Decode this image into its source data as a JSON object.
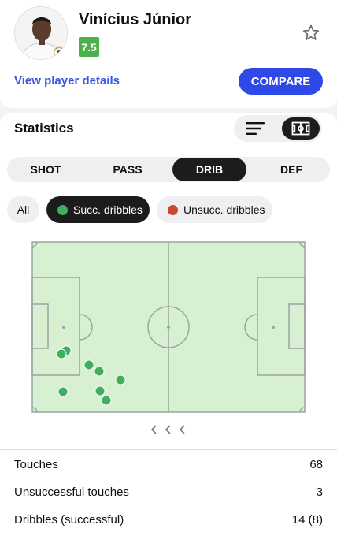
{
  "player": {
    "name": "Vinícius Júnior",
    "rating": "7.5",
    "details_link": "View player details",
    "compare_label": "COMPARE"
  },
  "icons": {
    "avatar": "player-photo",
    "club_badge": "real-madrid-crest",
    "favorite": "star-outline-icon",
    "list_view": "list-icon",
    "pitch_view": "pitch-icon",
    "pager": "chevron-left-icon"
  },
  "statistics": {
    "title": "Statistics",
    "tabs": [
      {
        "label": "SHOT",
        "active": false
      },
      {
        "label": "PASS",
        "active": false
      },
      {
        "label": "DRIB",
        "active": true
      },
      {
        "label": "DEF",
        "active": false
      }
    ],
    "filters": [
      {
        "label": "All",
        "active": false
      },
      {
        "label": "Succ. dribbles",
        "active": true,
        "color": "#3fae5f"
      },
      {
        "label": "Unsucc. dribbles",
        "active": false,
        "color": "#c94a32"
      }
    ]
  },
  "colors": {
    "accent": "#2f49e8",
    "rating_bg": "#4cb14a",
    "pitch_bg": "#d7f0d1",
    "pitch_lines": "#9aa6a0",
    "dribble_success": "#3fae5f"
  },
  "rows": [
    {
      "label": "Touches",
      "value": "68"
    },
    {
      "label": "Unsuccessful touches",
      "value": "3"
    },
    {
      "label": "Dribbles (successful)",
      "value": "14 (8)"
    }
  ]
}
